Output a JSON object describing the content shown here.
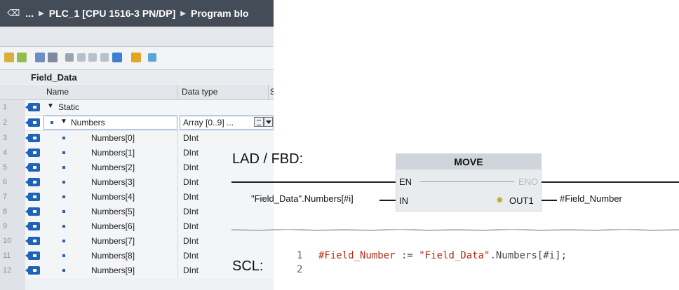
{
  "window": {
    "breadcrumb": [
      "...",
      "PLC_1 [CPU 1516-3 PN/DP]",
      "Program blo"
    ]
  },
  "block": {
    "title": "Field_Data",
    "columns": {
      "name": "Name",
      "data_type": "Data type",
      "cut": "S"
    },
    "rows": [
      {
        "num": "1",
        "name": "Static",
        "type": ""
      },
      {
        "num": "2",
        "name": "Numbers",
        "type": "Array [0..9] ..."
      },
      {
        "num": "3",
        "name": "Numbers[0]",
        "type": "DInt"
      },
      {
        "num": "4",
        "name": "Numbers[1]",
        "type": "DInt"
      },
      {
        "num": "5",
        "name": "Numbers[2]",
        "type": "DInt"
      },
      {
        "num": "6",
        "name": "Numbers[3]",
        "type": "DInt"
      },
      {
        "num": "7",
        "name": "Numbers[4]",
        "type": "DInt"
      },
      {
        "num": "8",
        "name": "Numbers[5]",
        "type": "DInt"
      },
      {
        "num": "9",
        "name": "Numbers[6]",
        "type": "DInt"
      },
      {
        "num": "10",
        "name": "Numbers[7]",
        "type": "DInt"
      },
      {
        "num": "11",
        "name": "Numbers[8]",
        "type": "DInt"
      },
      {
        "num": "12",
        "name": "Numbers[9]",
        "type": "DInt"
      }
    ]
  },
  "lad": {
    "label": "LAD / FBD:",
    "box_title": "MOVE",
    "en": "EN",
    "eno": "ENO",
    "in": "IN",
    "out1": "OUT1",
    "input_operand": "\"Field_Data\".Numbers[#i]",
    "output_operand": "#Field_Number"
  },
  "scl": {
    "label": "SCL:",
    "line1": "1",
    "line2": "2",
    "code_var": "#Field_Number",
    "code_op": " := ",
    "code_str": "\"Field_Data\"",
    "code_rest": ".Numbers[#i];"
  },
  "colors": {
    "titlebar": "#444c58",
    "code_red": "#b22c12",
    "icon_blue": "#1f63b7"
  }
}
